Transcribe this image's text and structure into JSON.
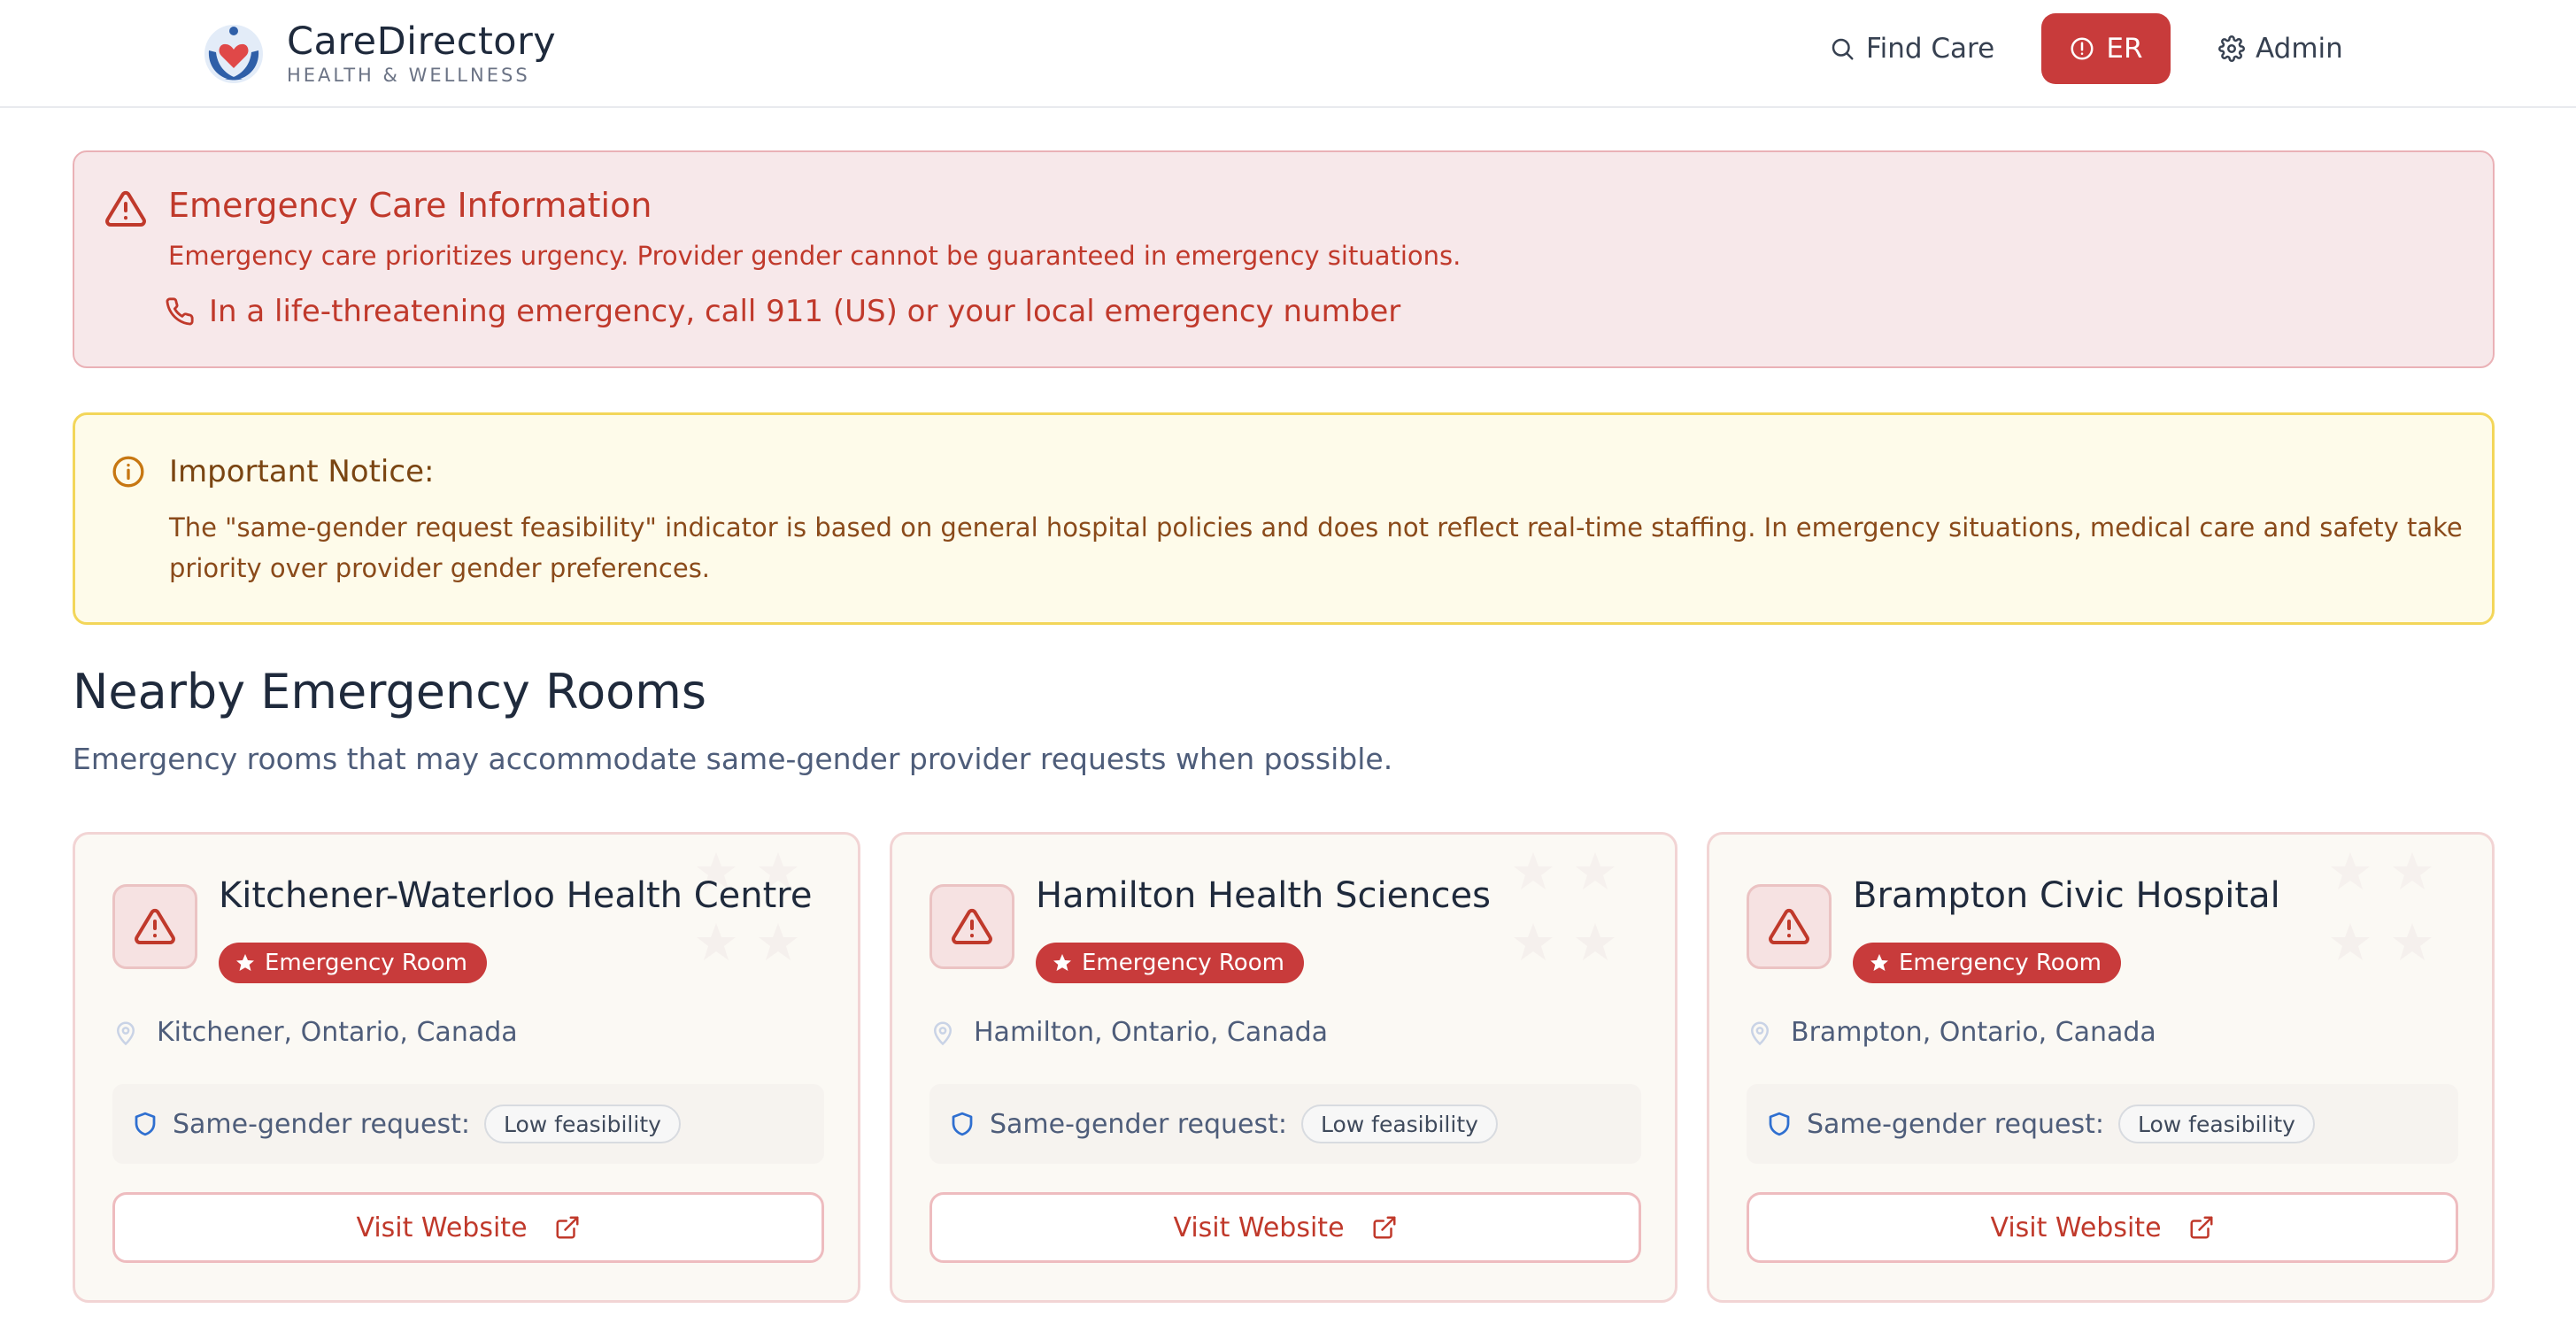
{
  "header": {
    "brand_name": "CareDirectory",
    "brand_tagline": "HEALTH & WELLNESS",
    "nav": {
      "find_care": "Find Care",
      "er": "ER",
      "admin": "Admin"
    }
  },
  "emergency_alert": {
    "title": "Emergency Care Information",
    "body": "Emergency care prioritizes urgency. Provider gender cannot be guaranteed in emergency situations.",
    "phone_note": "In a life-threatening emergency, call 911 (US) or your local emergency number"
  },
  "notice": {
    "title": "Important Notice:",
    "body": "The \"same-gender request feasibility\" indicator is based on general hospital policies and does not reflect real-time staffing. In emergency situations, medical care and safety take priority over provider gender preferences."
  },
  "section": {
    "title": "Nearby Emergency Rooms",
    "subtitle": "Emergency rooms that may accommodate same-gender provider requests when possible."
  },
  "cards": [
    {
      "name": "Kitchener-Waterloo Health Centre",
      "badge": "Emergency Room",
      "location": "Kitchener, Ontario, Canada",
      "same_gender_label": "Same-gender request:",
      "feasibility": "Low feasibility",
      "visit_label": "Visit Website"
    },
    {
      "name": "Hamilton Health Sciences",
      "badge": "Emergency Room",
      "location": "Hamilton, Ontario, Canada",
      "same_gender_label": "Same-gender request:",
      "feasibility": "Low feasibility",
      "visit_label": "Visit Website"
    },
    {
      "name": "Brampton Civic Hospital",
      "badge": "Emergency Room",
      "location": "Brampton, Ontario, Canada",
      "same_gender_label": "Same-gender request:",
      "feasibility": "Low feasibility",
      "visit_label": "Visit Website"
    }
  ],
  "colors": {
    "accent_red": "#c83b3b",
    "alert_bg": "#f7e8ea",
    "notice_bg": "#fefbea",
    "notice_border": "#f3d65a",
    "text_dark": "#1f2a3c"
  }
}
